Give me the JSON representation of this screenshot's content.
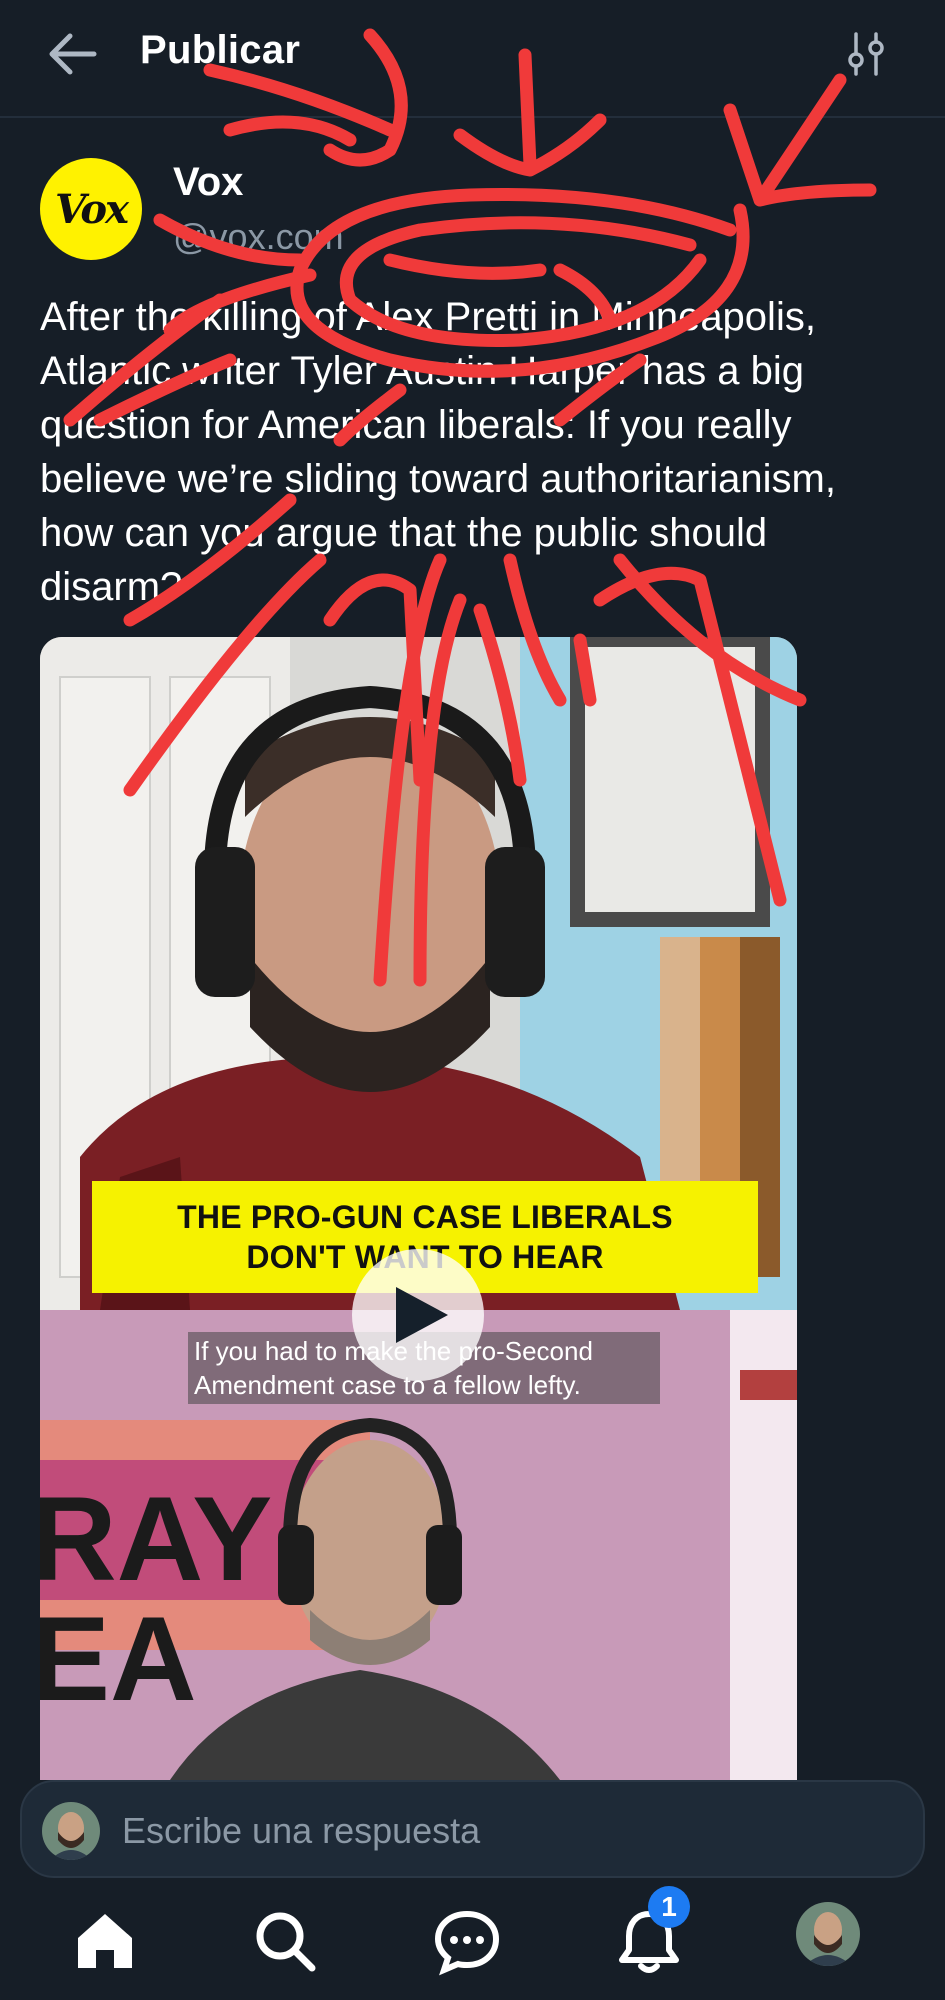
{
  "header": {
    "title": "Publicar",
    "back_icon": "arrow-left-icon",
    "filter_icon": "sliders-icon"
  },
  "post": {
    "author_name": "Vox",
    "author_handle": "@vox.com",
    "avatar_text": "Vox",
    "text": "After the killing of Alex Pretti in Minneapolis, Atlantic writer Tyler Austin Harper has a big question for American liberals: If you really believe we’re sliding toward authoritarianism, how can you argue that the public should disarm?"
  },
  "video": {
    "headline_line1": "THE PRO-GUN CASE LIBERALS",
    "headline_line2": "DON'T WANT TO HEAR",
    "caption_line1": "If you had to make the pro-Second",
    "caption_line2": "Amendment case to a fellow lefty.",
    "play_icon": "play-icon"
  },
  "reply": {
    "placeholder": "Escribe una respuesta"
  },
  "nav": {
    "items": [
      "home-icon",
      "search-icon",
      "chat-icon",
      "bell-icon",
      "profile-avatar"
    ],
    "notification_count": "1"
  },
  "colors": {
    "background": "#161e27",
    "accent": "#1d7bf2",
    "scribble": "#f03a3a",
    "headline_band": "#f6f200"
  }
}
